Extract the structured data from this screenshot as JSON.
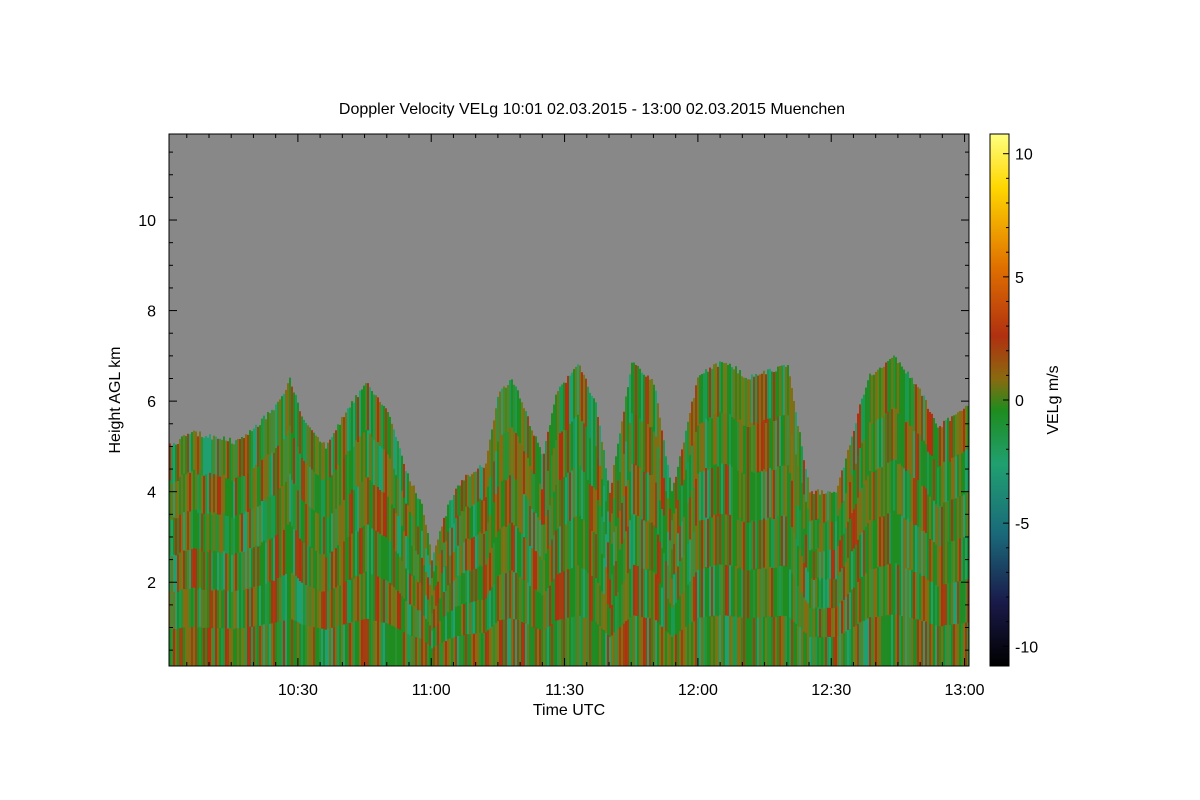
{
  "chart_data": {
    "type": "heatmap",
    "title": "Doppler Velocity VELg   10:01 02.03.2015 - 13:00 02.03.2015 Muenchen",
    "xlabel": "Time UTC",
    "ylabel": "Height AGL km",
    "colorbar_label": "VELg m/s",
    "x_range_minutes_utc": [
      601,
      781
    ],
    "y_range_km": [
      0.15,
      11.9
    ],
    "x_ticks": [
      {
        "minutes": 630,
        "label": "10:30"
      },
      {
        "minutes": 660,
        "label": "11:00"
      },
      {
        "minutes": 690,
        "label": "11:30"
      },
      {
        "minutes": 720,
        "label": "12:00"
      },
      {
        "minutes": 750,
        "label": "12:30"
      },
      {
        "minutes": 780,
        "label": "13:00"
      }
    ],
    "y_ticks": [
      {
        "value": 2,
        "label": "2"
      },
      {
        "value": 4,
        "label": "4"
      },
      {
        "value": 6,
        "label": "6"
      },
      {
        "value": 8,
        "label": "8"
      },
      {
        "value": 10,
        "label": "10"
      }
    ],
    "colorbar_range": [
      -10.8,
      10.8
    ],
    "colorbar_ticks": [
      {
        "value": 10,
        "label": "10"
      },
      {
        "value": 5,
        "label": "5"
      },
      {
        "value": 0,
        "label": "0"
      },
      {
        "value": -5,
        "label": "-5"
      },
      {
        "value": -10,
        "label": "-10"
      }
    ],
    "colormap": [
      "#000000",
      "#1a1a4a",
      "#1a6a7a",
      "#20a070",
      "#1e8c1e",
      "#8a6a10",
      "#b03010",
      "#e07000",
      "#ffd700",
      "#ffff80"
    ],
    "background_color": "#888888",
    "cloud_top_profile_km": [
      [
        601,
        5.0
      ],
      [
        606,
        5.3
      ],
      [
        611,
        5.2
      ],
      [
        616,
        5.1
      ],
      [
        621,
        5.5
      ],
      [
        626,
        6.0
      ],
      [
        628,
        6.5
      ],
      [
        631,
        5.6
      ],
      [
        636,
        5.0
      ],
      [
        641,
        5.8
      ],
      [
        645,
        6.4
      ],
      [
        650,
        5.8
      ],
      [
        654,
        4.5
      ],
      [
        658,
        3.6
      ],
      [
        660,
        2.5
      ],
      [
        664,
        3.8
      ],
      [
        667,
        4.3
      ],
      [
        672,
        4.6
      ],
      [
        675,
        6.2
      ],
      [
        678,
        6.5
      ],
      [
        682,
        5.5
      ],
      [
        685,
        4.8
      ],
      [
        688,
        6.2
      ],
      [
        693,
        6.8
      ],
      [
        697,
        5.9
      ],
      [
        700,
        4.0
      ],
      [
        705,
        6.9
      ],
      [
        710,
        6.4
      ],
      [
        714,
        4.0
      ],
      [
        720,
        6.6
      ],
      [
        726,
        6.9
      ],
      [
        731,
        6.5
      ],
      [
        740,
        6.8
      ],
      [
        745,
        4.0
      ],
      [
        751,
        4.0
      ],
      [
        758,
        6.5
      ],
      [
        764,
        7.0
      ],
      [
        770,
        6.2
      ],
      [
        774,
        5.4
      ],
      [
        781,
        6.0
      ]
    ]
  }
}
